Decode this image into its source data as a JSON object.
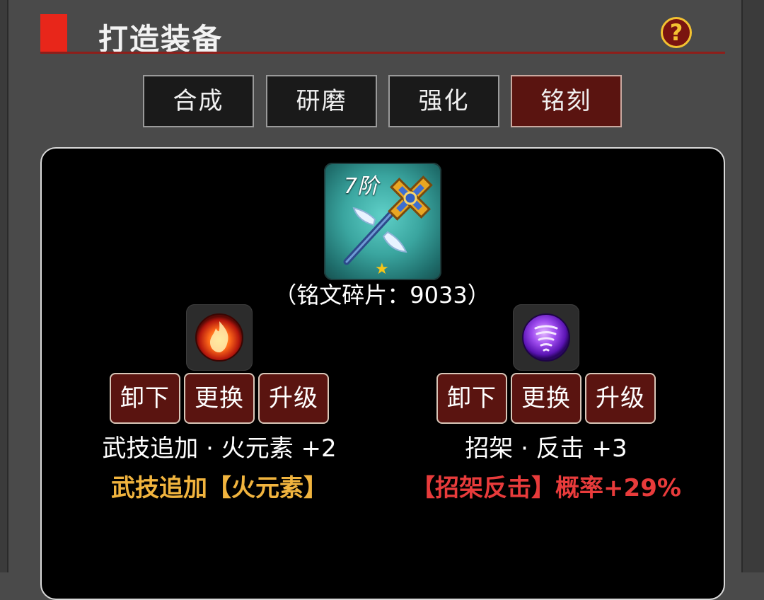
{
  "header": {
    "title": "打造装备",
    "help_label": "?"
  },
  "tabs": [
    {
      "label": "合成",
      "active": false
    },
    {
      "label": "研磨",
      "active": false
    },
    {
      "label": "强化",
      "active": false
    },
    {
      "label": "铭刻",
      "active": true
    }
  ],
  "item": {
    "tier": "7阶",
    "star": "★",
    "icon": "scepter-icon"
  },
  "fragments_text": "（铭文碎片：9033）",
  "runes": [
    {
      "icon": "fire-rune-icon",
      "buttons": {
        "unequip": "卸下",
        "replace": "更换",
        "upgrade": "升级"
      },
      "name": "武技追加 · 火元素 +2",
      "effect": "武技追加【火元素】",
      "effect_color": "#f1b43e"
    },
    {
      "icon": "tornado-rune-icon",
      "buttons": {
        "unequip": "卸下",
        "replace": "更换",
        "upgrade": "升级"
      },
      "name": "招架 · 反击 +3",
      "effect": "【招架反击】概率+29%",
      "effect_color": "#e83b3b"
    }
  ],
  "colors": {
    "accent_red": "#e8261a",
    "active_tab": "#5a1410",
    "button_bg": "#5a1410"
  }
}
